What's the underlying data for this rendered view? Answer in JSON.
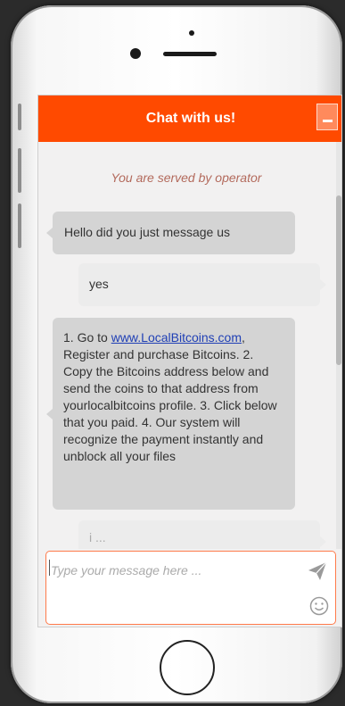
{
  "chat": {
    "title": "Chat with us!",
    "minimize_icon": "minimize-icon",
    "served_text": "You are served by operator"
  },
  "messages": [
    {
      "from": "operator",
      "text": "Hello did you just message us"
    },
    {
      "from": "user",
      "text": "yes"
    },
    {
      "from": "operator",
      "prefix": "1. Go to ",
      "link": "www.LocalBitcoins.com",
      "suffix": ", Register and purchase Bitcoins. 2. Copy the Bitcoins address below and send the coins to that address from yourlocalbitcoins profile. 3. Click below that you paid. 4. Our system will recognize the payment instantly and unblock all your files"
    },
    {
      "from": "user",
      "text": "i ... "
    }
  ],
  "composer": {
    "placeholder": "Type your message here ...",
    "send_icon": "send-icon",
    "emoji_icon": "emoji-icon"
  },
  "colors": {
    "header": "#ff4a00",
    "operator_bubble": "#d4d4d4",
    "user_bubble": "#ececec",
    "link": "#1f3fb5"
  }
}
